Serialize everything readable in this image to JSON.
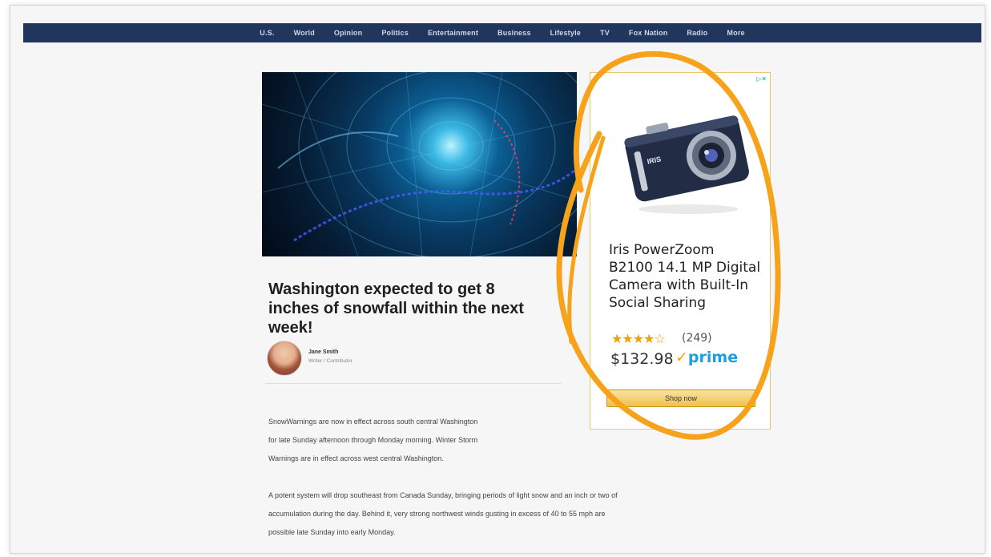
{
  "nav": {
    "items": [
      "U.S.",
      "World",
      "Opinion",
      "Politics",
      "Entertainment",
      "Business",
      "Lifestyle",
      "TV",
      "Fox Nation",
      "Radio",
      "More"
    ]
  },
  "article": {
    "headline": "Washington expected to get 8 inches of snowfall within the next week!",
    "author_name": "Jane Smith",
    "author_role": "Writer / Contributor",
    "paragraphs": [
      [
        "SnowWarnings are now in effect across south central Washington",
        "for late Sunday afternoon through Monday morning.  Winter Storm",
        "Warnings are in effect across west central Washington."
      ],
      [
        "A potent system will drop southeast from Canada Sunday, bringing periods of light snow and an inch or two of",
        "accumulation during the day. Behind it, very strong northwest winds gusting in excess of 40 to 55 mph are",
        "possible late Sunday into early Monday."
      ]
    ]
  },
  "ad": {
    "title_lines": [
      "Iris PowerZoom",
      "B2100 14.1 MP Digital",
      "Camera with Built-In",
      "Social Sharing"
    ],
    "rating_stars": 4.5,
    "review_count": "(249)",
    "price": "$132.98",
    "prime_label": "prime",
    "shop_button": "Shop now",
    "camera_brand": "IRIS"
  },
  "colors": {
    "nav_bg": "#21365c",
    "highlight": "#f7a21b",
    "prime_blue": "#1aa0e0",
    "star": "#e8a400"
  }
}
